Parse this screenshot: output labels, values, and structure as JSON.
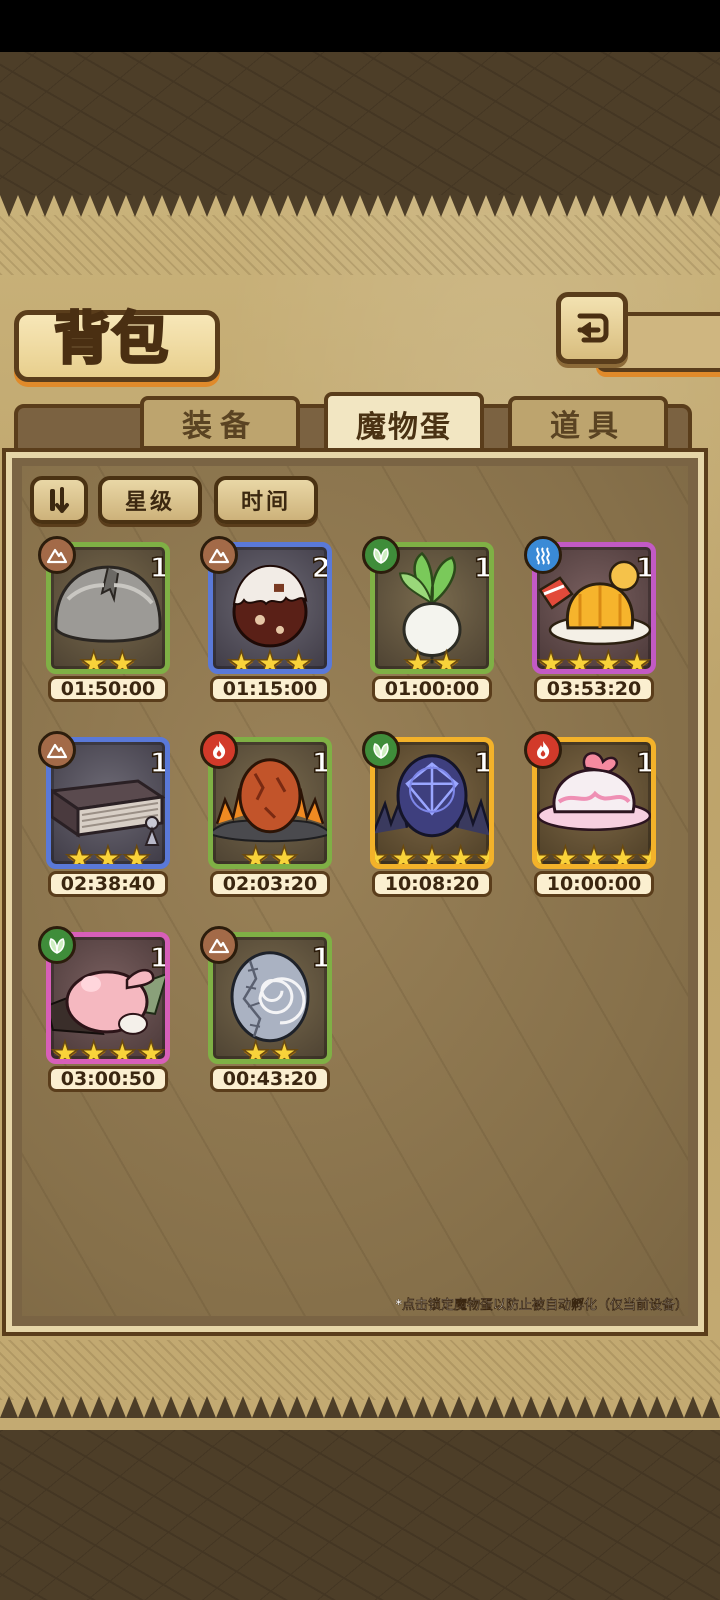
{
  "page": {
    "title": "背包",
    "back_icon": "return-icon"
  },
  "tabs": [
    {
      "label": "装备",
      "active": false
    },
    {
      "label": "魔物蛋",
      "active": true
    },
    {
      "label": "道具",
      "active": false
    }
  ],
  "filters": {
    "sort_icon": "sort-order-icon",
    "star_label": "星级",
    "time_label": "时间"
  },
  "items": [
    {
      "name": "gray-hair-egg",
      "element": "earth",
      "count": "1",
      "stars": 2,
      "time": "01:50:00",
      "rarity": "green"
    },
    {
      "name": "chocolate-egg",
      "element": "earth",
      "count": "2",
      "stars": 3,
      "time": "01:15:00",
      "rarity": "blue"
    },
    {
      "name": "turnip-egg",
      "element": "plant",
      "count": "1",
      "stars": 2,
      "time": "01:00:00",
      "rarity": "green"
    },
    {
      "name": "jelly-dessert-egg",
      "element": "water",
      "count": "1",
      "stars": 4,
      "time": "03:53:20",
      "rarity": "purple"
    },
    {
      "name": "book-egg",
      "element": "earth",
      "count": "1",
      "stars": 3,
      "time": "02:38:40",
      "rarity": "blue"
    },
    {
      "name": "fire-nest-egg",
      "element": "fire",
      "count": "1",
      "stars": 2,
      "time": "02:03:20",
      "rarity": "green"
    },
    {
      "name": "crystal-egg",
      "element": "plant",
      "count": "1",
      "stars": 5,
      "time": "10:08:20",
      "rarity": "gold"
    },
    {
      "name": "cream-cake-egg",
      "element": "fire",
      "count": "1",
      "stars": 5,
      "time": "10:00:00",
      "rarity": "gold"
    },
    {
      "name": "pink-bunny-egg",
      "element": "plant",
      "count": "1",
      "stars": 4,
      "time": "03:00:50",
      "rarity": "pink"
    },
    {
      "name": "stitched-stone-egg",
      "element": "earth",
      "count": "1",
      "stars": 2,
      "time": "00:43:20",
      "rarity": "green"
    }
  ],
  "hint": "*点击锁定魔物蛋以防止被自动孵化（仅当前设备）",
  "colors": {
    "earth": "#a36a48",
    "plant": "#3f8d3a",
    "fire": "#d23a2a",
    "water": "#3a8ad6",
    "star": "#f9d33a"
  }
}
